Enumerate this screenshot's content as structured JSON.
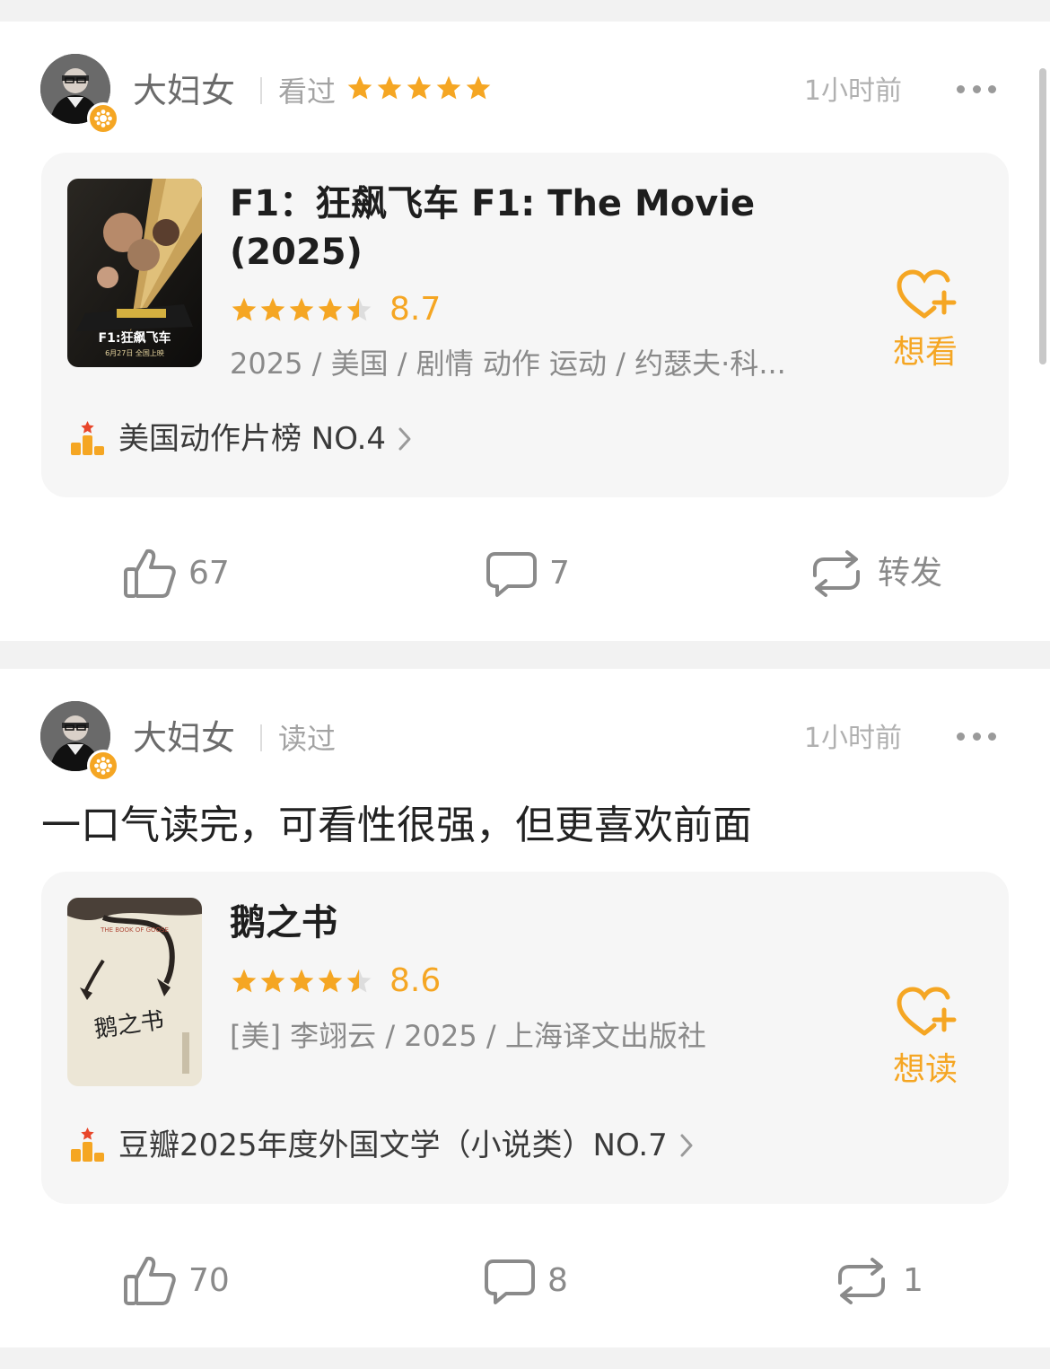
{
  "colors": {
    "accent": "#f5a623",
    "muted": "#8a8a8a",
    "card_bg": "#f6f6f6"
  },
  "posts": [
    {
      "username": "大妇女",
      "action": "看过",
      "user_stars": 5,
      "time": "1小时前",
      "comment": "",
      "card": {
        "title": "F1：狂飙飞车 F1: The Movie (2025)",
        "score": "8.7",
        "score_stars": 4.5,
        "meta": "2025 / 美国 / 剧情 动作 运动 / 约瑟夫·科...",
        "want_label": "想看",
        "rank_text": "美国动作片榜 NO.4",
        "poster_text": "F1:狂飙飞车",
        "poster_date": "6月27日 全国上映"
      },
      "likes": "67",
      "comments": "7",
      "share": "转发"
    },
    {
      "username": "大妇女",
      "action": "读过",
      "time": "1小时前",
      "comment": "一口气读完，可看性很强，但更喜欢前面",
      "card": {
        "title": "鹅之书",
        "score": "8.6",
        "score_stars": 4.5,
        "meta": "[美] 李翊云 / 2025 / 上海译文出版社",
        "want_label": "想读",
        "rank_text": "豆瓣2025年度外国文学（小说类）NO.7",
        "poster_text": "鹅之书",
        "poster_subtitle": "THE BOOK OF GOOSE"
      },
      "likes": "70",
      "comments": "8",
      "share": "1"
    }
  ],
  "icons": [
    "avatar-badge-icon",
    "more-icon",
    "star-icon",
    "heart-plus-icon",
    "rank-icon",
    "chevron-right-icon",
    "like-icon",
    "comment-icon",
    "repost-icon"
  ]
}
